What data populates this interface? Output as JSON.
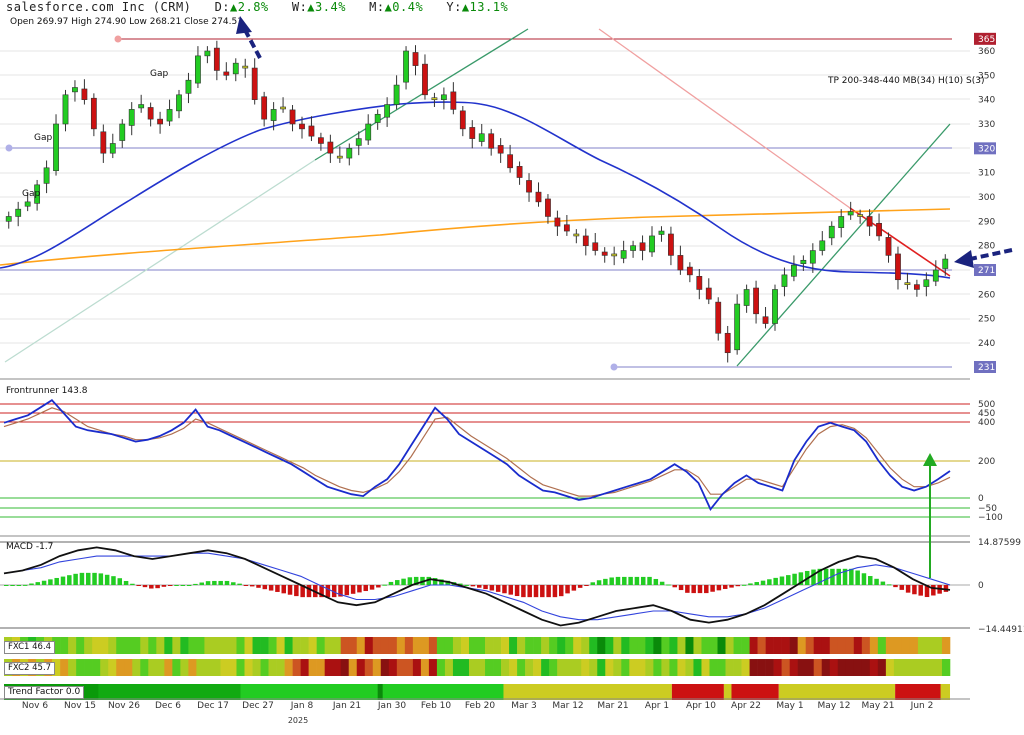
{
  "header": {
    "title": "salesforce.com Inc (CRM)",
    "changes": [
      {
        "label": "D:",
        "value": "▲2.8%"
      },
      {
        "label": "W:",
        "value": "▲3.4%"
      },
      {
        "label": "M:",
        "value": "▲0.4%"
      },
      {
        "label": "Y:",
        "value": "▲13.1%"
      }
    ],
    "ohlc": "Open 269.97  High 274.90  Low 268.21  Close 274.51"
  },
  "annotations": {
    "tp": "TP 200-348-440 MB(34) H(10) S(3)",
    "gaps": [
      "Gap",
      "Gap",
      "Gap"
    ]
  },
  "panels": {
    "frontrunner_label": "Frontrunner 143.8",
    "macd_label": "MACD -1.7",
    "fxc1_label": "FXC1 46.4",
    "fxc2_label": "FXC2 45.7",
    "trend_label": "Trend Factor 0.0"
  },
  "x_axis": {
    "labels": [
      "Nov 6",
      "Nov 15",
      "Nov 26",
      "Dec 6",
      "Dec 17",
      "Dec 27",
      "Jan 8",
      "Jan 21",
      "Jan 30",
      "Feb 10",
      "Feb 20",
      "Mar 3",
      "Mar 12",
      "Mar 21",
      "Apr 1",
      "Apr 10",
      "Apr 22",
      "May 1",
      "May 12",
      "May 21",
      "Jun 2"
    ],
    "year": "2025"
  },
  "colors": {
    "up": "#22cc22",
    "down": "#cc1111",
    "neutral": "#cccc22",
    "ma_blue": "#2233cc",
    "ma_orange": "#ffa21a",
    "trend_green": "#3a9a6a",
    "trend_red": "#e02020"
  },
  "chart_data": [
    {
      "type": "candlestick",
      "title": "salesforce.com Inc (CRM)",
      "y_ticks": [
        240,
        250,
        260,
        270,
        280,
        290,
        300,
        310,
        320,
        330,
        340,
        350,
        360
      ],
      "y_range": [
        231,
        365
      ],
      "price_tags": [
        "365",
        "320",
        "271",
        "231"
      ],
      "close_approx": [
        292,
        295,
        298,
        305,
        312,
        330,
        342,
        345,
        340,
        328,
        318,
        322,
        330,
        336,
        338,
        332,
        330,
        336,
        342,
        348,
        358,
        360,
        352,
        350,
        355,
        353,
        340,
        332,
        336,
        337,
        330,
        328,
        325,
        322,
        318,
        316,
        320,
        324,
        330,
        334,
        338,
        346,
        360,
        354,
        342,
        340,
        342,
        336,
        328,
        324,
        326,
        320,
        318,
        312,
        308,
        302,
        298,
        292,
        288,
        286,
        284,
        280,
        278,
        276,
        276,
        278,
        280,
        278,
        284,
        286,
        276,
        270,
        268,
        262,
        258,
        244,
        236,
        256,
        262,
        252,
        248,
        262,
        268,
        272,
        274,
        278,
        282,
        288,
        292,
        294,
        292,
        288,
        284,
        276,
        266,
        264,
        262,
        266,
        270,
        274.5
      ],
      "ma_blue_approx": [
        270,
        274,
        280,
        288,
        296,
        304,
        312,
        318,
        322,
        327,
        332,
        335,
        337,
        339,
        340,
        341,
        342,
        343,
        340,
        333,
        324,
        316,
        308,
        302,
        297,
        293,
        290,
        287,
        284,
        282,
        280,
        278,
        276,
        274,
        272,
        271,
        270,
        270,
        269
      ],
      "ma_orange_approx": [
        271,
        273,
        275,
        277,
        279,
        281,
        283,
        285,
        287,
        289,
        291,
        292,
        293,
        294,
        295,
        295,
        295
      ]
    },
    {
      "type": "line",
      "title": "Frontrunner 143.8",
      "y_ticks": [
        500,
        450,
        400,
        200,
        0,
        -50,
        -100
      ],
      "series": [
        {
          "values": [
            400,
            420,
            440,
            480,
            520,
            450,
            380,
            360,
            350,
            340,
            320,
            300,
            310,
            330,
            360,
            400,
            470,
            380,
            360,
            330,
            300,
            270,
            240,
            210,
            180,
            140,
            100,
            60,
            40,
            20,
            10,
            60,
            100,
            180,
            280,
            380,
            480,
            420,
            340,
            300,
            260,
            220,
            180,
            120,
            80,
            40,
            30,
            10,
            -10,
            0,
            20,
            40,
            60,
            80,
            100,
            140,
            180,
            140,
            80,
            -60,
            20,
            80,
            120,
            80,
            60,
            40,
            200,
            300,
            380,
            400,
            380,
            360,
            300,
            200,
            120,
            60,
            40,
            60,
            100,
            143.8
          ]
        },
        {
          "values": [
            380,
            400,
            420,
            450,
            480,
            460,
            420,
            380,
            360,
            340,
            330,
            310,
            310,
            320,
            340,
            370,
            420,
            400,
            370,
            340,
            310,
            280,
            250,
            220,
            190,
            160,
            120,
            90,
            60,
            40,
            30,
            50,
            80,
            140,
            220,
            320,
            420,
            430,
            380,
            330,
            290,
            250,
            210,
            160,
            110,
            70,
            50,
            30,
            10,
            10,
            20,
            30,
            50,
            70,
            90,
            120,
            150,
            150,
            110,
            20,
            20,
            60,
            100,
            100,
            80,
            60,
            160,
            260,
            340,
            380,
            390,
            370,
            320,
            240,
            160,
            100,
            60,
            60,
            80,
            110
          ]
        }
      ]
    },
    {
      "type": "line",
      "title": "MACD -1.7",
      "y_ticks": [
        14.87599,
        0,
        -14.44911
      ],
      "series": [
        {
          "values": [
            4,
            5,
            7,
            10,
            12,
            13,
            12,
            10,
            9,
            10,
            11,
            12,
            11,
            9,
            6,
            3,
            0,
            -3,
            -6,
            -7,
            -6,
            -3,
            0,
            2,
            1,
            -1,
            -3,
            -6,
            -9,
            -12,
            -14,
            -13,
            -11,
            -9,
            -8,
            -7,
            -9,
            -12,
            -13,
            -12,
            -10,
            -7,
            -3,
            1,
            5,
            8,
            10,
            9,
            6,
            2,
            -1,
            -1.7
          ]
        },
        {
          "values": [
            4,
            5,
            6,
            8,
            9,
            10,
            10,
            10,
            10,
            10,
            11,
            11,
            10,
            9,
            7,
            5,
            3,
            0,
            -3,
            -5,
            -5,
            -4,
            -2,
            0,
            0,
            -1,
            -2,
            -4,
            -6,
            -9,
            -11,
            -12,
            -12,
            -11,
            -10,
            -9,
            -9,
            -10,
            -11,
            -11,
            -10,
            -8,
            -5,
            -2,
            1,
            4,
            6,
            7,
            6,
            4,
            2,
            0
          ]
        }
      ]
    }
  ]
}
